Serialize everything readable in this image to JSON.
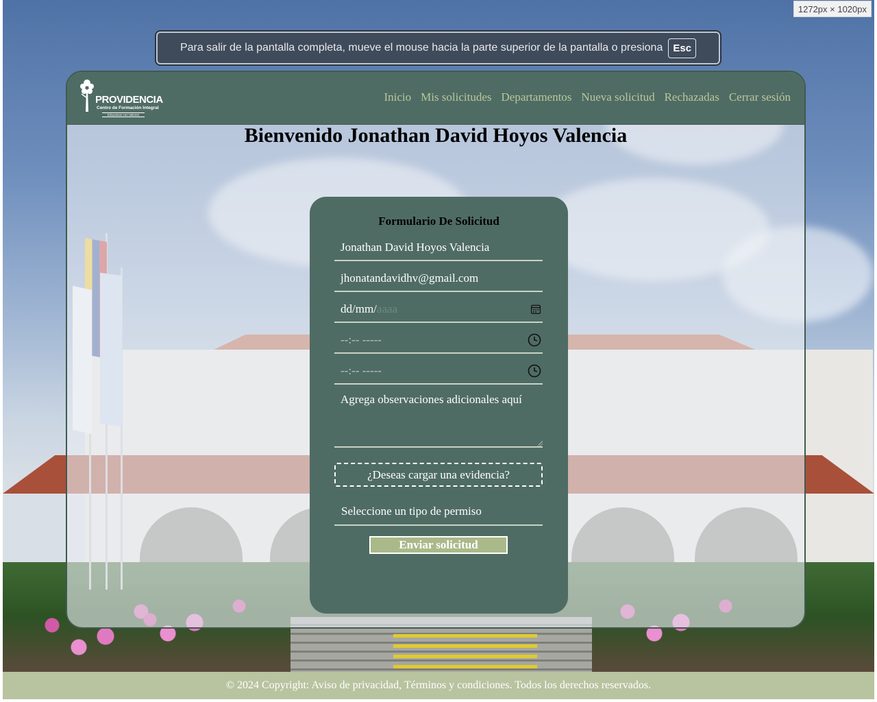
{
  "devtools": {
    "size_badge": "1272px × 1020px"
  },
  "fullscreen_notice": {
    "message": "Para salir de la pantalla completa, mueve el mouse hacia la parte superior de la pantalla o presiona",
    "key": "Esc"
  },
  "brand": {
    "name": "PROVIDENCIA",
    "subtitle": "Centro de Formación Integral",
    "tagline": "Educamos con Valores"
  },
  "nav": {
    "items": [
      {
        "label": "Inicio"
      },
      {
        "label": "Mis solicitudes"
      },
      {
        "label": "Departamentos"
      },
      {
        "label": "Nueva solicitud"
      },
      {
        "label": "Rechazadas"
      },
      {
        "label": "Cerrar sesión"
      }
    ]
  },
  "welcome": "Bienvenido Jonathan David Hoyos Valencia",
  "form": {
    "title": "Formulario De Solicitud",
    "name_value": "Jonathan David Hoyos Valencia",
    "email_value": "jhonatandavidhv@gmail.com",
    "date_placeholder": "dd/mm/",
    "date_placeholder_year": "aaaa",
    "time_start_placeholder": "--:-- -----",
    "time_end_placeholder": "--:-- -----",
    "observations_placeholder": "Agrega observaciones adicionales aquí",
    "evidence_label": "¿Deseas cargar una evidencia?",
    "permission_select": "Seleccione un tipo de permiso",
    "submit_label": "Enviar solicitud"
  },
  "footer": {
    "text": "© 2024 Copyright: Aviso de privacidad, Términos y condiciones. Todos los derechos reservados."
  },
  "colors": {
    "nav_bg": "#4f6c64",
    "nav_link": "#b9c79b",
    "form_bg": "#4f6c64",
    "submit_bg": "#aab98a",
    "footer_bg": "#b8c39f"
  }
}
